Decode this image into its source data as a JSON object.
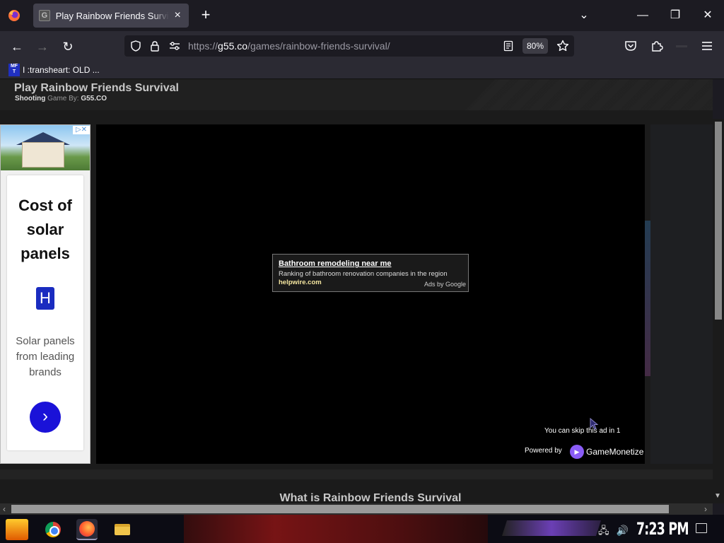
{
  "browser": {
    "tab": {
      "title": "Play Rainbow Friends Survival",
      "close_icon": "×"
    },
    "new_tab_icon": "+",
    "window_controls": {
      "list_tabs": "⌄",
      "minimize": "—",
      "restore": "❐",
      "close": "✕"
    },
    "nav": {
      "back": "←",
      "forward": "→",
      "reload": "↻"
    },
    "url": {
      "scheme": "https://",
      "host": "g55.co",
      "path": "/games/rainbow-friends-survival/"
    },
    "zoom": "80%",
    "bookmark": {
      "icon_text": "MF T",
      "label": "I :transheart: OLD ..."
    }
  },
  "page": {
    "title": "Play Rainbow Friends Survival",
    "subtitle": {
      "category": "Shooting",
      "middle": " Game By: ",
      "author": "G55.CO"
    },
    "left_ad": {
      "adchoices": "▷✕",
      "headline": "Cost of solar panels",
      "logo_letter": "H",
      "description": "Solar panels from leading brands",
      "cta_icon": "›"
    },
    "game": {
      "ad": {
        "title": "Bathroom remodeling near me",
        "description": "Ranking of bathroom renovation companies in the region",
        "url": "helpwire.com",
        "ads_by": "Ads by Google"
      },
      "skip_text": "You can skip this ad in 1",
      "powered_by": "Powered by",
      "brand": "GameMonetize"
    },
    "section_heading": "What is Rainbow Friends Survival"
  },
  "taskbar": {
    "clock": "7:23 PM",
    "apps": [
      "chrome",
      "firefox",
      "file-explorer"
    ]
  },
  "colors": {
    "tab_active": "#42414d",
    "toolbar": "#2b2a33",
    "ad_cta": "#1a12d8",
    "page_bg": "#1b1b1b"
  }
}
